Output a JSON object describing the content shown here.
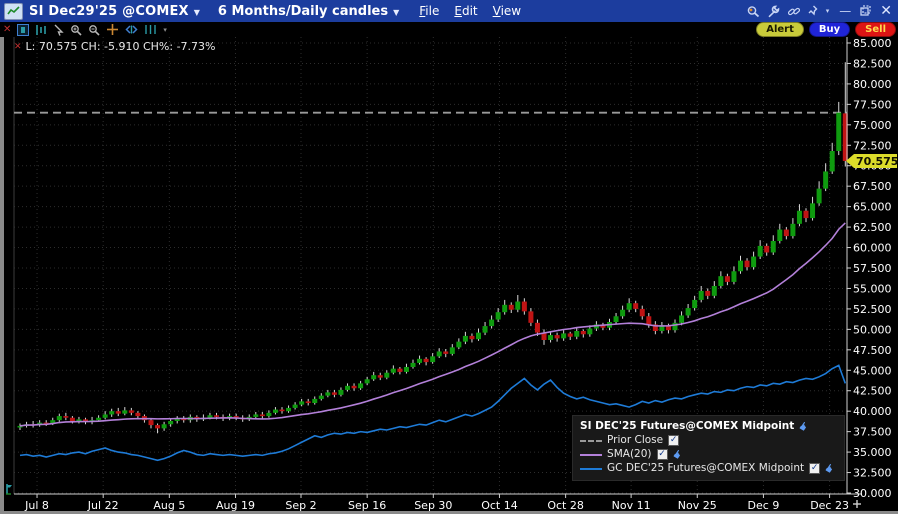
{
  "window": {
    "title_symbol": "SI Dec29'25 @COMEX",
    "title_timeframe": "6 Months/Daily candles",
    "menus": [
      "File",
      "Edit",
      "View"
    ],
    "controls": {
      "minimize": "—",
      "close": "✕"
    }
  },
  "toolbar": {
    "alert_label": "Alert",
    "buy_label": "Buy",
    "sell_label": "Sell"
  },
  "readout": {
    "text": "L: 70.575 CH: -5.910 CH%: -7.73%"
  },
  "price_tag": "70.575",
  "legend": {
    "title": "SI DEC'25 Futures@COMEX Midpoint",
    "items": [
      {
        "label": "Prior Close",
        "style": "dashed",
        "checked": true,
        "hand": false
      },
      {
        "label": "SMA(20)",
        "style": "solid",
        "checked": true,
        "hand": true
      },
      {
        "label": "GC DEC'25 Futures@COMEX Midpoint",
        "style": "solid",
        "checked": true,
        "hand": true
      }
    ]
  },
  "chart_data": {
    "type": "candlestick",
    "title": "SI DEC'25 Futures@COMEX Midpoint, Daily, 6 Months",
    "last": 70.575,
    "change": -5.91,
    "change_pct": -7.73,
    "prior_close": 76.485,
    "y_axis": {
      "min": 30.0,
      "max": 85.0,
      "step": 2.5,
      "label_format": "3dp"
    },
    "x_ticks": [
      {
        "label": "Jul 8",
        "index": 2.6
      },
      {
        "label": "Jul 22",
        "index": 12.7
      },
      {
        "label": "Aug 5",
        "index": 22.8
      },
      {
        "label": "Aug 19",
        "index": 32.9
      },
      {
        "label": "Sep 2",
        "index": 42.9
      },
      {
        "label": "Sep 16",
        "index": 53.0
      },
      {
        "label": "Sep 30",
        "index": 63.1
      },
      {
        "label": "Oct 14",
        "index": 73.2
      },
      {
        "label": "Oct 28",
        "index": 83.3
      },
      {
        "label": "Nov 11",
        "index": 93.3
      },
      {
        "label": "Nov 25",
        "index": 103.4
      },
      {
        "label": "Dec 9",
        "index": 113.5
      },
      {
        "label": "Dec 23",
        "index": 123.6
      }
    ],
    "candles_format": [
      "open",
      "high",
      "low",
      "close"
    ],
    "candles": [
      [
        38.0,
        38.5,
        37.7,
        38.2
      ],
      [
        38.2,
        38.7,
        38.0,
        38.4
      ],
      [
        38.4,
        38.8,
        38.0,
        38.3
      ],
      [
        38.3,
        38.9,
        38.1,
        38.6
      ],
      [
        38.6,
        38.9,
        38.2,
        38.5
      ],
      [
        38.5,
        39.2,
        38.3,
        38.9
      ],
      [
        38.9,
        39.7,
        38.7,
        39.4
      ],
      [
        39.4,
        39.8,
        38.9,
        39.2
      ],
      [
        39.2,
        39.4,
        38.5,
        38.8
      ],
      [
        38.8,
        39.3,
        38.5,
        39.0
      ],
      [
        39.0,
        39.2,
        38.4,
        38.7
      ],
      [
        38.7,
        39.3,
        38.4,
        38.9
      ],
      [
        38.9,
        39.5,
        38.7,
        39.2
      ],
      [
        39.2,
        40.0,
        39.0,
        39.6
      ],
      [
        39.6,
        40.3,
        39.3,
        40.0
      ],
      [
        40.0,
        40.4,
        39.4,
        39.7
      ],
      [
        39.7,
        40.5,
        39.5,
        40.1
      ],
      [
        40.1,
        40.4,
        39.5,
        39.8
      ],
      [
        39.8,
        40.0,
        39.1,
        39.4
      ],
      [
        39.4,
        39.6,
        38.6,
        38.9
      ],
      [
        38.9,
        39.1,
        37.9,
        38.3
      ],
      [
        38.3,
        38.5,
        37.3,
        37.9
      ],
      [
        37.9,
        38.7,
        37.6,
        38.4
      ],
      [
        38.4,
        39.1,
        38.1,
        38.8
      ],
      [
        38.8,
        39.4,
        38.5,
        39.1
      ],
      [
        39.1,
        39.4,
        38.6,
        38.9
      ],
      [
        38.9,
        39.6,
        38.6,
        39.3
      ],
      [
        39.3,
        39.5,
        38.7,
        39.0
      ],
      [
        39.0,
        39.6,
        38.8,
        39.2
      ],
      [
        39.2,
        39.8,
        39.0,
        39.5
      ],
      [
        39.5,
        39.8,
        39.0,
        39.3
      ],
      [
        39.3,
        39.6,
        38.8,
        39.1
      ],
      [
        39.1,
        39.7,
        38.9,
        39.4
      ],
      [
        39.4,
        39.7,
        38.9,
        39.2
      ],
      [
        39.2,
        39.5,
        38.7,
        39.0
      ],
      [
        39.0,
        39.6,
        38.8,
        39.3
      ],
      [
        39.3,
        39.9,
        39.1,
        39.6
      ],
      [
        39.6,
        39.9,
        39.1,
        39.4
      ],
      [
        39.4,
        40.1,
        39.2,
        39.8
      ],
      [
        39.8,
        40.5,
        39.6,
        40.2
      ],
      [
        40.2,
        40.5,
        39.7,
        40.0
      ],
      [
        40.0,
        40.7,
        39.8,
        40.4
      ],
      [
        40.4,
        41.1,
        40.2,
        40.8
      ],
      [
        40.8,
        41.5,
        40.6,
        41.2
      ],
      [
        41.2,
        41.5,
        40.7,
        41.0
      ],
      [
        41.0,
        41.8,
        40.8,
        41.5
      ],
      [
        41.5,
        42.2,
        41.3,
        41.9
      ],
      [
        41.9,
        42.6,
        41.7,
        42.3
      ],
      [
        42.3,
        42.6,
        41.7,
        42.0
      ],
      [
        42.0,
        42.9,
        41.8,
        42.6
      ],
      [
        42.6,
        43.4,
        42.4,
        43.1
      ],
      [
        43.1,
        43.4,
        42.5,
        42.8
      ],
      [
        42.8,
        43.7,
        42.6,
        43.4
      ],
      [
        43.4,
        44.2,
        43.2,
        43.9
      ],
      [
        43.9,
        44.8,
        43.7,
        44.4
      ],
      [
        44.4,
        44.7,
        43.8,
        44.1
      ],
      [
        44.1,
        45.0,
        43.9,
        44.7
      ],
      [
        44.7,
        45.6,
        44.5,
        45.2
      ],
      [
        45.2,
        45.4,
        44.5,
        44.8
      ],
      [
        44.8,
        45.8,
        44.6,
        45.4
      ],
      [
        45.4,
        46.3,
        45.2,
        45.9
      ],
      [
        45.9,
        46.8,
        45.7,
        46.4
      ],
      [
        46.4,
        46.6,
        45.6,
        46.0
      ],
      [
        46.0,
        47.1,
        45.8,
        46.7
      ],
      [
        46.7,
        47.7,
        46.5,
        47.3
      ],
      [
        47.3,
        47.6,
        46.6,
        47.0
      ],
      [
        47.0,
        48.2,
        46.8,
        47.8
      ],
      [
        47.8,
        48.9,
        47.6,
        48.5
      ],
      [
        48.5,
        49.7,
        48.2,
        49.2
      ],
      [
        49.2,
        49.5,
        48.4,
        48.8
      ],
      [
        48.8,
        50.1,
        48.6,
        49.6
      ],
      [
        49.6,
        50.9,
        49.3,
        50.4
      ],
      [
        50.4,
        51.7,
        50.1,
        51.2
      ],
      [
        51.2,
        52.6,
        50.9,
        52.1
      ],
      [
        52.1,
        53.6,
        51.8,
        53.0
      ],
      [
        53.0,
        53.3,
        52.0,
        52.4
      ],
      [
        52.4,
        54.2,
        52.1,
        53.4
      ],
      [
        53.4,
        53.8,
        51.8,
        52.2
      ],
      [
        52.2,
        52.6,
        50.4,
        50.8
      ],
      [
        50.8,
        51.2,
        49.2,
        49.6
      ],
      [
        49.6,
        50.0,
        48.1,
        48.7
      ],
      [
        48.7,
        49.8,
        48.4,
        49.3
      ],
      [
        49.3,
        49.6,
        48.5,
        48.9
      ],
      [
        48.9,
        49.9,
        48.6,
        49.5
      ],
      [
        49.5,
        49.7,
        48.7,
        49.1
      ],
      [
        49.1,
        50.2,
        48.8,
        49.8
      ],
      [
        49.8,
        50.0,
        49.0,
        49.4
      ],
      [
        49.4,
        50.5,
        49.1,
        50.1
      ],
      [
        50.1,
        51.0,
        49.8,
        50.6
      ],
      [
        50.6,
        50.8,
        49.9,
        50.2
      ],
      [
        50.2,
        51.3,
        49.9,
        50.9
      ],
      [
        50.9,
        52.0,
        50.6,
        51.6
      ],
      [
        51.6,
        52.9,
        51.3,
        52.4
      ],
      [
        52.4,
        53.8,
        52.1,
        53.2
      ],
      [
        53.2,
        53.5,
        52.1,
        52.5
      ],
      [
        52.5,
        52.9,
        51.2,
        51.6
      ],
      [
        51.6,
        52.0,
        50.2,
        50.6
      ],
      [
        50.6,
        51.0,
        49.4,
        49.8
      ],
      [
        49.8,
        50.9,
        49.5,
        50.5
      ],
      [
        50.5,
        50.7,
        49.5,
        49.9
      ],
      [
        49.9,
        51.2,
        49.6,
        50.8
      ],
      [
        50.8,
        52.2,
        50.5,
        51.7
      ],
      [
        51.7,
        53.1,
        51.4,
        52.6
      ],
      [
        52.6,
        54.1,
        52.3,
        53.6
      ],
      [
        53.6,
        55.3,
        53.3,
        54.7
      ],
      [
        54.7,
        55.0,
        53.7,
        54.1
      ],
      [
        54.1,
        55.9,
        53.8,
        55.3
      ],
      [
        55.3,
        57.1,
        55.0,
        56.5
      ],
      [
        56.5,
        56.8,
        55.4,
        55.8
      ],
      [
        55.8,
        57.7,
        55.5,
        57.1
      ],
      [
        57.1,
        59.0,
        56.8,
        58.4
      ],
      [
        58.4,
        58.7,
        57.2,
        57.6
      ],
      [
        57.6,
        59.5,
        57.3,
        58.9
      ],
      [
        58.9,
        60.9,
        58.6,
        60.2
      ],
      [
        60.2,
        60.5,
        59.0,
        59.4
      ],
      [
        59.4,
        61.5,
        59.1,
        60.8
      ],
      [
        60.8,
        62.9,
        60.5,
        62.2
      ],
      [
        62.2,
        62.5,
        61.0,
        61.4
      ],
      [
        61.4,
        63.6,
        61.1,
        62.9
      ],
      [
        62.9,
        65.3,
        62.6,
        64.5
      ],
      [
        64.5,
        64.8,
        63.1,
        63.6
      ],
      [
        63.6,
        66.2,
        63.3,
        65.4
      ],
      [
        65.4,
        68.1,
        65.1,
        67.2
      ],
      [
        67.2,
        70.3,
        66.9,
        69.3
      ],
      [
        69.3,
        72.8,
        69.0,
        71.8
      ],
      [
        71.8,
        77.8,
        71.3,
        76.485
      ],
      [
        76.4,
        82.65,
        69.9,
        70.575
      ]
    ],
    "overlays": {
      "sma": {
        "name": "SMA(20)",
        "window": 20,
        "source": "close"
      },
      "gc": {
        "name": "GC DEC'25 Futures@COMEX Midpoint",
        "values": [
          34.6,
          34.7,
          34.5,
          34.6,
          34.4,
          34.6,
          34.8,
          34.7,
          34.9,
          35.0,
          34.8,
          35.1,
          35.3,
          35.5,
          35.2,
          35.0,
          34.9,
          34.7,
          34.6,
          34.4,
          34.2,
          34.0,
          34.2,
          34.5,
          34.9,
          35.2,
          35.0,
          34.7,
          34.6,
          34.8,
          34.7,
          34.6,
          34.7,
          34.6,
          34.5,
          34.6,
          34.7,
          34.6,
          34.8,
          34.9,
          35.1,
          35.4,
          35.8,
          36.2,
          36.6,
          37.0,
          36.8,
          37.1,
          37.3,
          37.2,
          37.4,
          37.3,
          37.5,
          37.4,
          37.6,
          37.8,
          37.7,
          37.9,
          38.1,
          38.0,
          38.2,
          38.4,
          38.3,
          38.6,
          38.9,
          38.7,
          39.0,
          39.3,
          39.6,
          39.4,
          39.7,
          40.1,
          40.5,
          41.2,
          42.0,
          42.8,
          43.4,
          44.0,
          43.2,
          42.6,
          43.3,
          43.8,
          42.9,
          42.2,
          41.8,
          41.5,
          41.7,
          41.4,
          41.2,
          41.0,
          40.8,
          40.9,
          40.7,
          40.5,
          40.8,
          41.2,
          41.0,
          41.3,
          41.1,
          41.4,
          41.6,
          41.5,
          41.8,
          42.0,
          42.2,
          42.1,
          42.4,
          42.3,
          42.6,
          42.5,
          42.8,
          43.0,
          42.9,
          43.2,
          43.1,
          43.4,
          43.3,
          43.6,
          43.5,
          43.8,
          44.0,
          43.9,
          44.2,
          44.6,
          45.2,
          45.6,
          43.4
        ]
      }
    },
    "colors": {
      "up": "#0f9b0f",
      "down": "#c01414",
      "wick": "#d9d9d9",
      "sma": "#b380d9",
      "gc": "#1e7bd7",
      "prior_close": "#9a9a9a",
      "grid": "#2d2d2d",
      "axis": "#cfcfcf",
      "tag_bg": "#dcdc2a",
      "tag_text": "#101000"
    },
    "legend_position": "bottom-right",
    "grid": true
  }
}
